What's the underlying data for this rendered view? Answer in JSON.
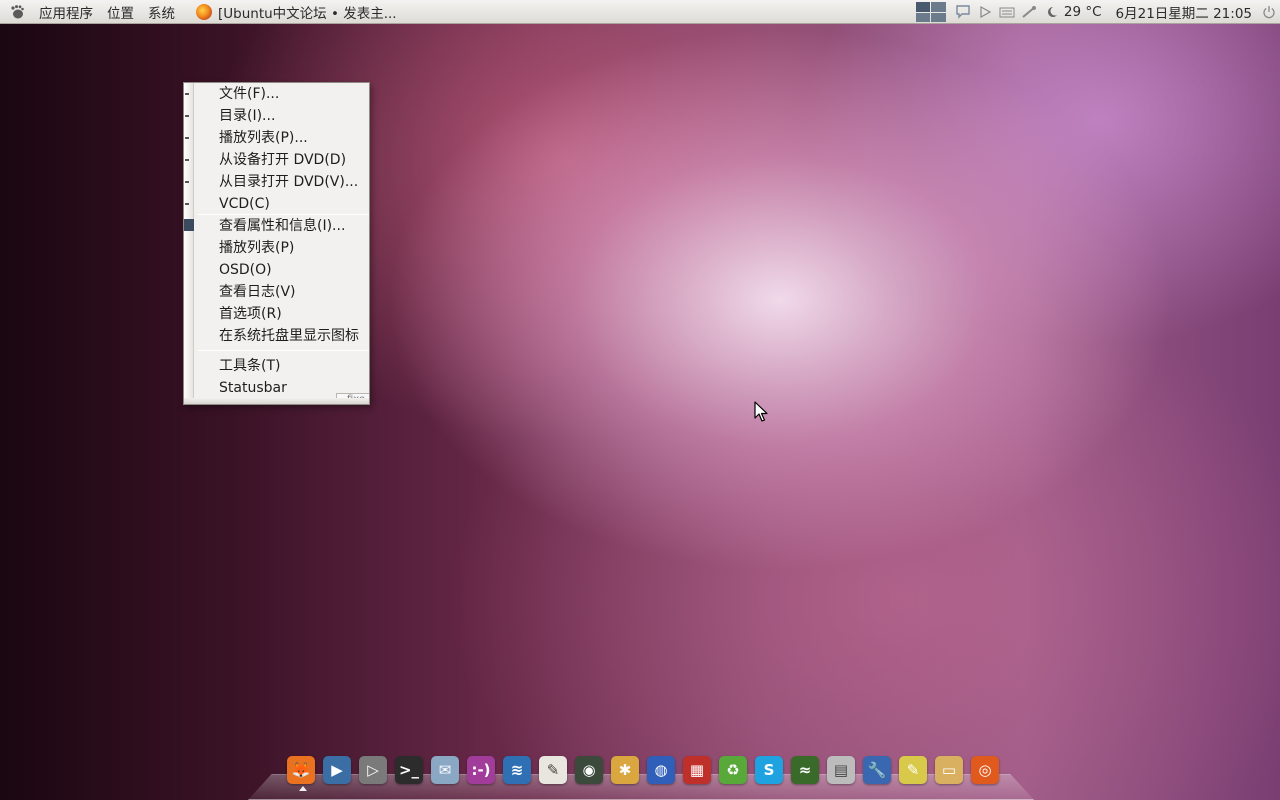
{
  "top_panel": {
    "menus": [
      "应用程序",
      "位置",
      "系统"
    ],
    "active_window": "[Ubuntu中文论坛 • 发表主...",
    "temperature": "29 °C",
    "clock": "6月21日星期二 21:05"
  },
  "context_menu": {
    "items": [
      "文件(F)...",
      "目录(I)...",
      "播放列表(P)...",
      "从设备打开 DVD(D)",
      "从目录打开 DVD(V)...",
      "VCD(C)",
      "查看属性和信息(I)...",
      "播放列表(P)",
      "OSD(O)",
      "查看日志(V)",
      "首选项(R)",
      "在系统托盘里显示图标",
      "工具条(T)",
      "Statusbar"
    ],
    "tooltip": "fixe"
  },
  "dock": {
    "apps": [
      {
        "name": "firefox",
        "color": "#e8721f",
        "glyph": "🦊"
      },
      {
        "name": "video-player",
        "color": "#3a6ea5",
        "glyph": "▶"
      },
      {
        "name": "media-player",
        "color": "#7a7a7a",
        "glyph": "▷"
      },
      {
        "name": "terminal",
        "color": "#2c2c2c",
        "glyph": ">_"
      },
      {
        "name": "mail",
        "color": "#8aa7c4",
        "glyph": "✉"
      },
      {
        "name": "chat",
        "color": "#a23c9a",
        "glyph": ":-)"
      },
      {
        "name": "office",
        "color": "#2f6fb3",
        "glyph": "≋"
      },
      {
        "name": "text-editor",
        "color": "#e9e6df",
        "glyph": "✎"
      },
      {
        "name": "disk",
        "color": "#3b4a3b",
        "glyph": "◉"
      },
      {
        "name": "image-editor",
        "color": "#d9a640",
        "glyph": "✱"
      },
      {
        "name": "globe",
        "color": "#2f5fb8",
        "glyph": "◍"
      },
      {
        "name": "package",
        "color": "#c0302a",
        "glyph": "▦"
      },
      {
        "name": "recycle",
        "color": "#58a83a",
        "glyph": "♻"
      },
      {
        "name": "skype",
        "color": "#1fa3e0",
        "glyph": "S"
      },
      {
        "name": "graphics",
        "color": "#3a6a2a",
        "glyph": "≈"
      },
      {
        "name": "calculator",
        "color": "#bcbcbc",
        "glyph": "▤"
      },
      {
        "name": "settings",
        "color": "#3a68b0",
        "glyph": "🔧"
      },
      {
        "name": "notes",
        "color": "#d9c94a",
        "glyph": "✎"
      },
      {
        "name": "folder",
        "color": "#d8b060",
        "glyph": "▭"
      },
      {
        "name": "ubuntu",
        "color": "#e05a1e",
        "glyph": "◎"
      }
    ]
  }
}
